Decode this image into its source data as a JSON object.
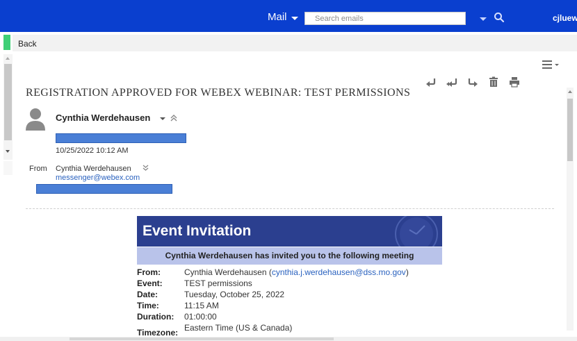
{
  "header": {
    "mail_label": "Mail",
    "search_placeholder": "Search emails",
    "user": "cjluew"
  },
  "nav": {
    "back_label": "Back"
  },
  "message": {
    "subject": "REGISTRATION APPROVED FOR WEBEX WEBINAR: TEST PERMISSIONS",
    "sender_name": "Cynthia Werdehausen",
    "date": "10/25/2022 10:12 AM",
    "from_label": "From",
    "from_name": "Cynthia Werdehausen",
    "from_email": "messenger@webex.com"
  },
  "invitation": {
    "title": "Event Invitation",
    "subtitle": "Cynthia Werdehausen has invited you to the following meeting",
    "details": [
      {
        "label": "From:",
        "value": "Cynthia Werdehausen (",
        "link": "cynthia.j.werdehausen@dss.mo.gov",
        "suffix": ")"
      },
      {
        "label": "Event:",
        "value": "TEST permissions"
      },
      {
        "label": "Date:",
        "value": "Tuesday, October 25, 2022"
      },
      {
        "label": "Time:",
        "value": "11:15 AM"
      },
      {
        "label": "Duration:",
        "value": "01:00:00"
      },
      {
        "label": "Timezone:",
        "value": "Eastern Time (US & Canada)"
      }
    ]
  },
  "colors": {
    "topbar": "#0a3fcf",
    "invite_header": "#2b3f8f",
    "invite_sub": "#b9c3ea",
    "link": "#2a62bf",
    "redaction": "#4a7fd6"
  },
  "icons": [
    "search-icon",
    "hamburger-menu-icon",
    "reply-icon",
    "reply-all-icon",
    "forward-icon",
    "delete-icon",
    "print-icon",
    "avatar-icon",
    "collapse-icon",
    "expand-icon",
    "clock-icon"
  ]
}
